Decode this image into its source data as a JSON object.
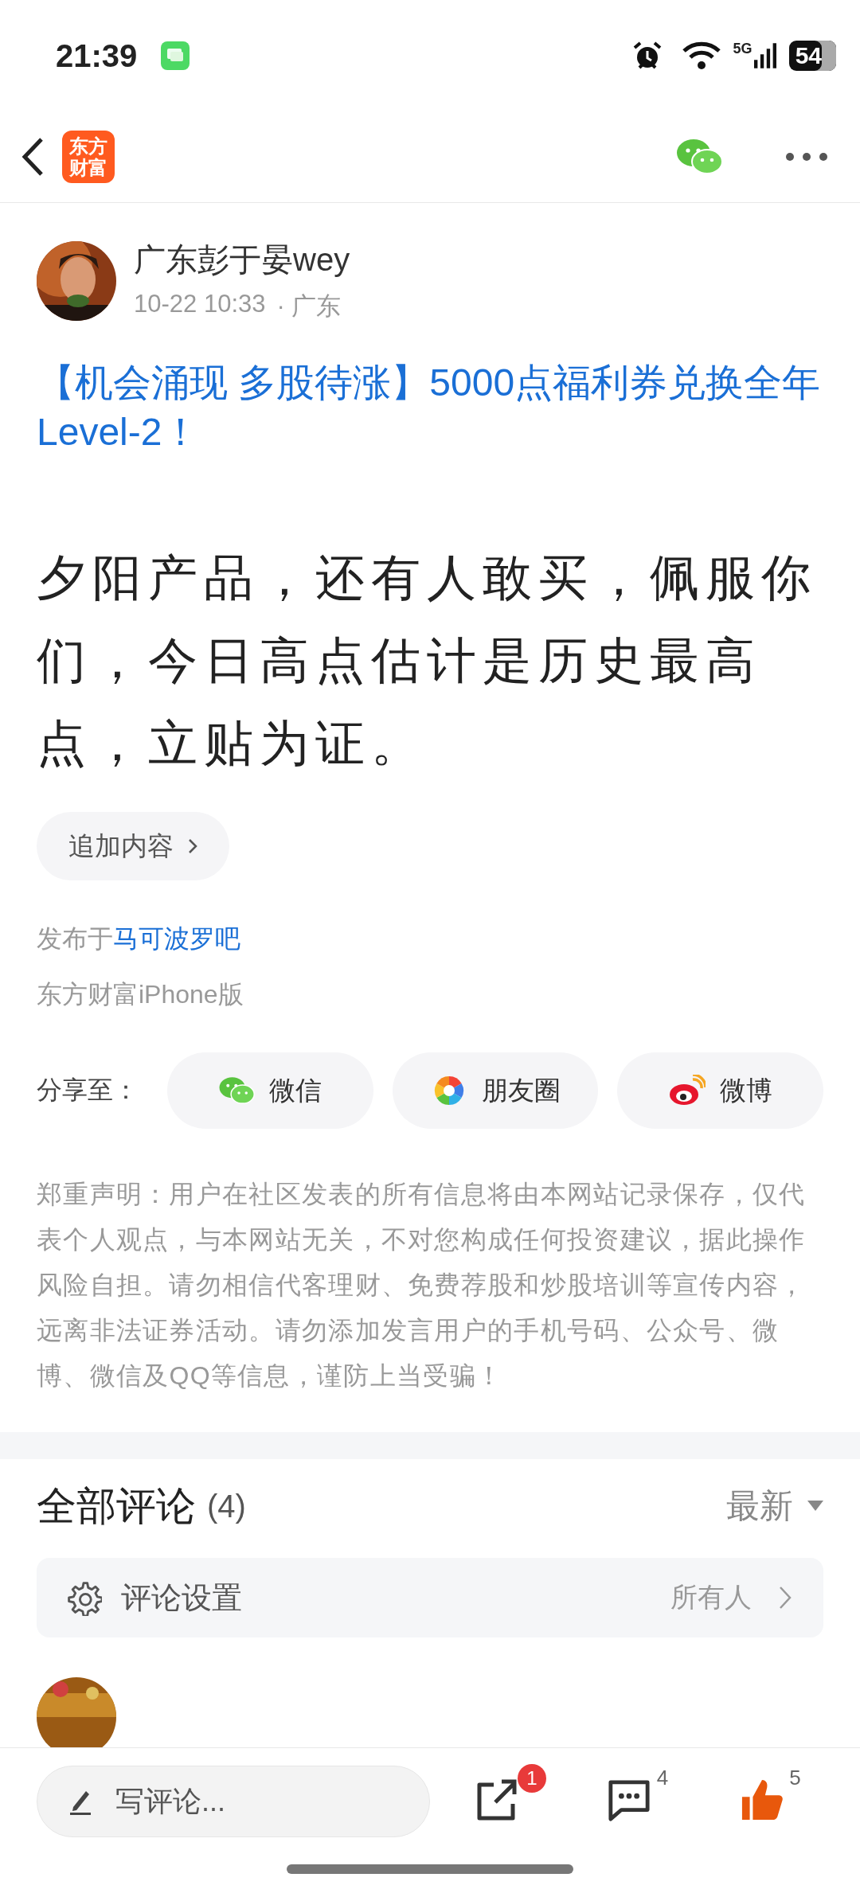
{
  "status_bar": {
    "time": "21:39",
    "network": "5G",
    "battery": "54"
  },
  "header": {
    "logo": [
      "东方",
      "财富"
    ]
  },
  "author": {
    "name": "广东彭于晏wey",
    "date": "10-22 10:33",
    "location": "· 广东"
  },
  "promo_link": "【机会涌现 多股待涨】5000点福利券兑换全年Level-2！",
  "post_body": "夕阳产品，还有人敢买，佩服你们，今日高点估计是历史最高点，立贴为证。",
  "append_button": "追加内容",
  "published_in": {
    "prefix": "发布于",
    "forum": "马可波罗吧"
  },
  "client": "东方财富iPhone版",
  "share": {
    "label": "分享至：",
    "targets": [
      {
        "kind": "wechat",
        "label": "微信"
      },
      {
        "kind": "moments",
        "label": "朋友圈"
      },
      {
        "kind": "weibo",
        "label": "微博"
      }
    ]
  },
  "disclaimer": "郑重声明：用户在社区发表的所有信息将由本网站记录保存，仅代表个人观点，与本网站无关，不对您构成任何投资建议，据此操作风险自担。请勿相信代客理财、免费荐股和炒股培训等宣传内容，远离非法证券活动。请勿添加发言用户的手机号码、公众号、微博、微信及QQ等信息，谨防上当受骗！",
  "comments": {
    "title": "全部评论",
    "count": "(4)",
    "sort": "最新",
    "settings": {
      "label": "评论设置",
      "value": "所有人"
    }
  },
  "bottom_bar": {
    "placeholder": "写评论...",
    "share_badge": "1",
    "comment_count": "4",
    "like_count": "5",
    "liked": true
  }
}
